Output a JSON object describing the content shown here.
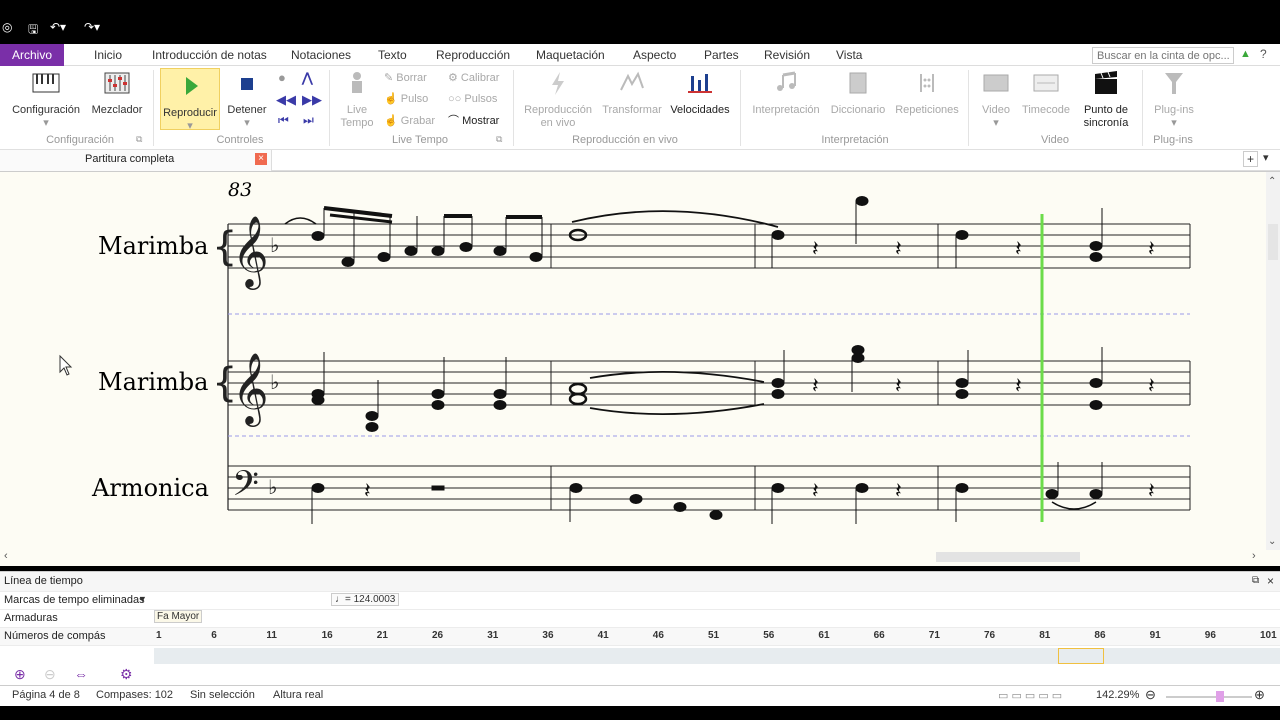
{
  "ribbon_tabs": [
    "Archivo",
    "Inicio",
    "Introducción de notas",
    "Notaciones",
    "Texto",
    "Reproducción",
    "Maquetación",
    "Aspecto",
    "Partes",
    "Revisión",
    "Vista"
  ],
  "search": {
    "placeholder": "Buscar en la cinta de opc..."
  },
  "ribbon": {
    "configuracion": "Configuración",
    "mezclador": "Mezclador",
    "reproducir": "Reproducir",
    "detener": "Detener",
    "live_tempo": "Live Tempo",
    "borrar": "Borrar",
    "pulso": "Pulso",
    "grabar": "Grabar",
    "calibrar": "Calibrar",
    "pulsos": "Pulsos",
    "mostrar": "Mostrar",
    "reproduccion_en_vivo": "Reproducción en vivo",
    "transformar": "Transformar",
    "velocidades": "Velocidades",
    "interpretacion": "Interpretación",
    "diccionario": "Diccionario",
    "repeticiones": "Repeticiones",
    "video": "Video",
    "timecode": "Timecode",
    "punto_de_sincronia": "Punto de sincronía",
    "plugins": "Plug-ins",
    "groups": {
      "configuracion": "Configuración",
      "controles": "Controles",
      "live_tempo": "Live Tempo",
      "reproduccion_en_vivo": "Reproducción en vivo",
      "interpretacion": "Interpretación",
      "video": "Video",
      "plugins": "Plug-ins"
    }
  },
  "document_tab": "Partitura completa",
  "score": {
    "measure_number": "83",
    "instruments": [
      "Marimba",
      "Marimba",
      "Armonica"
    ]
  },
  "timeline": {
    "title": "Línea de tiempo",
    "rows": [
      "Marcas de tempo eliminadas",
      "Armaduras",
      "Números de compás"
    ],
    "tempo": "♩= 124.0003",
    "key": "Fa Mayor",
    "bar_numbers": [
      "1",
      "6",
      "11",
      "16",
      "21",
      "26",
      "31",
      "36",
      "41",
      "46",
      "51",
      "56",
      "61",
      "66",
      "71",
      "76",
      "81",
      "86",
      "91",
      "96",
      "101"
    ]
  },
  "status": {
    "page": "Página 4 de 8",
    "bars": "Compases: 102",
    "selection": "Sin selección",
    "pitch": "Altura real",
    "zoom": "142.29%"
  },
  "colors": {
    "accent": "#7a2fa8",
    "playback_line": "#6cdc4a",
    "play": "#3aa83a"
  }
}
